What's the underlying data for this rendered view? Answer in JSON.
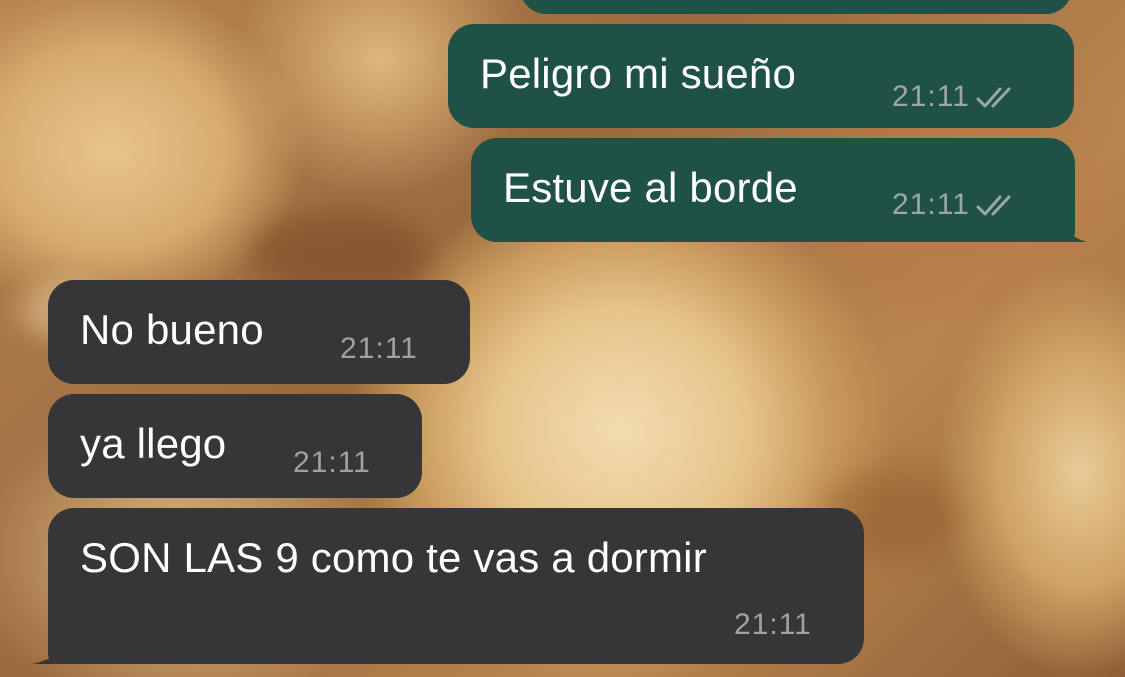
{
  "chat": {
    "messages": [
      {
        "direction": "outgoing",
        "text": "",
        "time": "",
        "status": "",
        "partial": true
      },
      {
        "direction": "outgoing",
        "text": "Peligro mi sueño",
        "time": "21:11",
        "status": "read-double-check"
      },
      {
        "direction": "outgoing",
        "text": "Estuve al borde",
        "time": "21:11",
        "status": "read-double-check"
      },
      {
        "direction": "incoming",
        "text": "No bueno",
        "time": "21:11"
      },
      {
        "direction": "incoming",
        "text": "ya llego",
        "time": "21:11"
      },
      {
        "direction": "incoming",
        "text": "SON LAS 9 como te vas a dormir",
        "time": "21:11"
      }
    ]
  },
  "colors": {
    "outgoing_bubble": "#1f5146",
    "incoming_bubble": "#363639",
    "text": "#ffffff",
    "meta_text": "#9aa7a3"
  },
  "icons": {
    "status": "double-check-icon"
  }
}
